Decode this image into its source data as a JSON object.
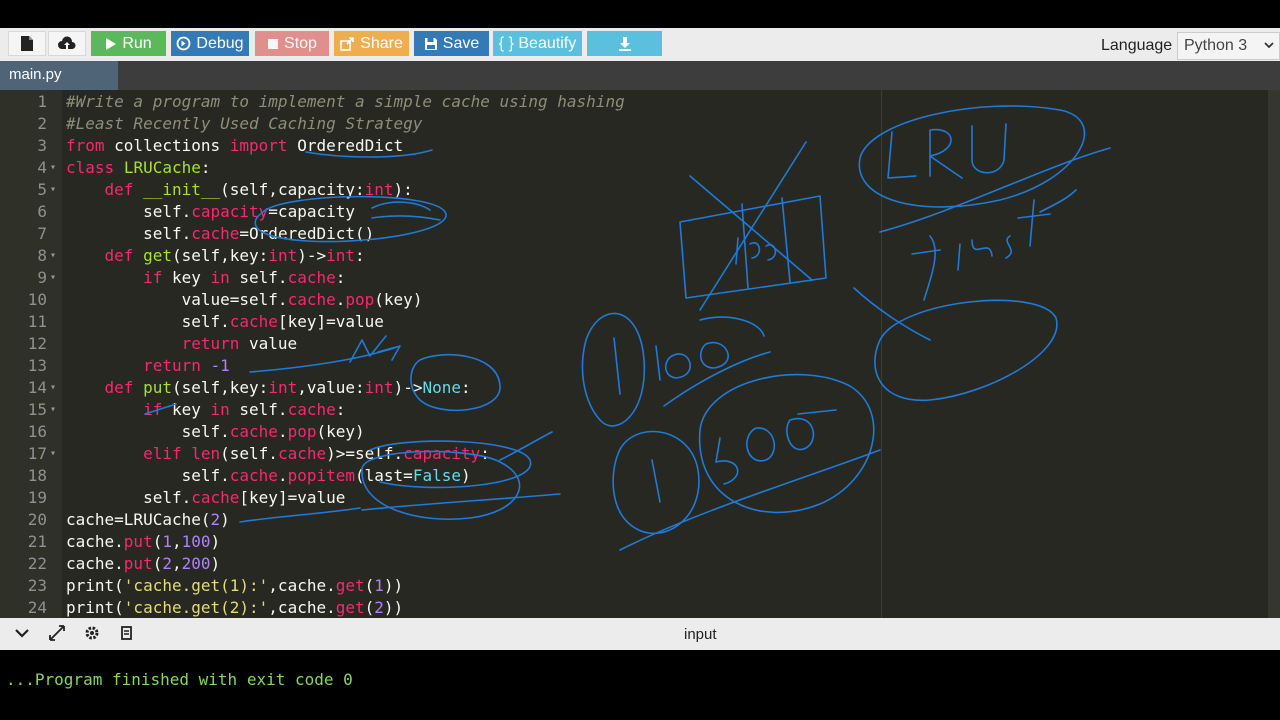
{
  "toolbar": {
    "run_label": "Run",
    "debug_label": "Debug",
    "stop_label": "Stop",
    "share_label": "Share",
    "save_label": "Save",
    "beautify_label": "{ } Beautify",
    "language_label": "Language",
    "language_value": "Python 3"
  },
  "tab": {
    "name": "main.py"
  },
  "editor": {
    "lines": [
      {
        "n": "1"
      },
      {
        "n": "2"
      },
      {
        "n": "3"
      },
      {
        "n": "4"
      },
      {
        "n": "5"
      },
      {
        "n": "6"
      },
      {
        "n": "7"
      },
      {
        "n": "8"
      },
      {
        "n": "9"
      },
      {
        "n": "10"
      },
      {
        "n": "11"
      },
      {
        "n": "12"
      },
      {
        "n": "13"
      },
      {
        "n": "14"
      },
      {
        "n": "15"
      },
      {
        "n": "16"
      },
      {
        "n": "17"
      },
      {
        "n": "18"
      },
      {
        "n": "19"
      },
      {
        "n": "20"
      },
      {
        "n": "21"
      },
      {
        "n": "22"
      },
      {
        "n": "23"
      },
      {
        "n": "24"
      }
    ],
    "code": [
      [
        [
          "c",
          "#Write a program to implement a simple cache using hashing"
        ]
      ],
      [
        [
          "c",
          "#Least Recently Used Caching Strategy"
        ]
      ],
      [
        [
          "k",
          "from"
        ],
        [
          "p",
          " collections "
        ],
        [
          "k",
          "import"
        ],
        [
          "p",
          " OrderedDict"
        ]
      ],
      [
        [
          "k",
          "class"
        ],
        [
          "p",
          " "
        ],
        [
          "f",
          "LRUCache"
        ],
        [
          "p",
          ":"
        ]
      ],
      [
        [
          "p",
          "    "
        ],
        [
          "k",
          "def"
        ],
        [
          "p",
          " "
        ],
        [
          "f",
          "__init__"
        ],
        [
          "p",
          "(self,capacity:"
        ],
        [
          "r",
          "int"
        ],
        [
          "p",
          "):"
        ]
      ],
      [
        [
          "p",
          "        self."
        ],
        [
          "r",
          "capacity"
        ],
        [
          "p",
          "=capacity"
        ]
      ],
      [
        [
          "p",
          "        self."
        ],
        [
          "r",
          "cache"
        ],
        [
          "p",
          "=OrderedDict()"
        ]
      ],
      [
        [
          "p",
          "    "
        ],
        [
          "k",
          "def"
        ],
        [
          "p",
          " "
        ],
        [
          "f",
          "get"
        ],
        [
          "p",
          "(self,key:"
        ],
        [
          "r",
          "int"
        ],
        [
          "p",
          ")->"
        ],
        [
          "r",
          "int"
        ],
        [
          "p",
          ":"
        ]
      ],
      [
        [
          "p",
          "        "
        ],
        [
          "k",
          "if"
        ],
        [
          "p",
          " key "
        ],
        [
          "k",
          "in"
        ],
        [
          "p",
          " self."
        ],
        [
          "r",
          "cache"
        ],
        [
          "p",
          ":"
        ]
      ],
      [
        [
          "p",
          "            value=self."
        ],
        [
          "r",
          "cache"
        ],
        [
          "p",
          "."
        ],
        [
          "r",
          "pop"
        ],
        [
          "p",
          "(key)"
        ]
      ],
      [
        [
          "p",
          "            self."
        ],
        [
          "r",
          "cache"
        ],
        [
          "p",
          "[key]=value"
        ]
      ],
      [
        [
          "p",
          "            "
        ],
        [
          "k",
          "return"
        ],
        [
          "p",
          " value"
        ]
      ],
      [
        [
          "p",
          "        "
        ],
        [
          "k",
          "return"
        ],
        [
          "p",
          " "
        ],
        [
          "n",
          "-1"
        ]
      ],
      [
        [
          "p",
          "    "
        ],
        [
          "k",
          "def"
        ],
        [
          "p",
          " "
        ],
        [
          "f",
          "put"
        ],
        [
          "p",
          "(self,key:"
        ],
        [
          "r",
          "int"
        ],
        [
          "p",
          ",value:"
        ],
        [
          "r",
          "int"
        ],
        [
          "p",
          ")->"
        ],
        [
          "b",
          "None"
        ],
        [
          "p",
          ":"
        ]
      ],
      [
        [
          "p",
          "        "
        ],
        [
          "k",
          "if"
        ],
        [
          "p",
          " key "
        ],
        [
          "k",
          "in"
        ],
        [
          "p",
          " self."
        ],
        [
          "r",
          "cache"
        ],
        [
          "p",
          ":"
        ]
      ],
      [
        [
          "p",
          "            self."
        ],
        [
          "r",
          "cache"
        ],
        [
          "p",
          "."
        ],
        [
          "r",
          "pop"
        ],
        [
          "p",
          "(key)"
        ]
      ],
      [
        [
          "p",
          "        "
        ],
        [
          "k",
          "elif"
        ],
        [
          "p",
          " "
        ],
        [
          "r",
          "len"
        ],
        [
          "p",
          "(self."
        ],
        [
          "r",
          "cache"
        ],
        [
          "p",
          ")>=self."
        ],
        [
          "r",
          "capacity"
        ],
        [
          "p",
          ":"
        ]
      ],
      [
        [
          "p",
          "            self."
        ],
        [
          "r",
          "cache"
        ],
        [
          "p",
          "."
        ],
        [
          "r",
          "popitem"
        ],
        [
          "p",
          "(last="
        ],
        [
          "b",
          "False"
        ],
        [
          "p",
          ")"
        ]
      ],
      [
        [
          "p",
          "        self."
        ],
        [
          "r",
          "cache"
        ],
        [
          "p",
          "[key]=value"
        ]
      ],
      [
        [
          "p",
          "cache=LRUCache("
        ],
        [
          "n",
          "2"
        ],
        [
          "p",
          ")"
        ]
      ],
      [
        [
          "p",
          "cache."
        ],
        [
          "r",
          "put"
        ],
        [
          "p",
          "("
        ],
        [
          "n",
          "1"
        ],
        [
          "p",
          ","
        ],
        [
          "n",
          "100"
        ],
        [
          "p",
          ")"
        ]
      ],
      [
        [
          "p",
          "cache."
        ],
        [
          "r",
          "put"
        ],
        [
          "p",
          "("
        ],
        [
          "n",
          "2"
        ],
        [
          "p",
          ","
        ],
        [
          "n",
          "200"
        ],
        [
          "p",
          ")"
        ]
      ],
      [
        [
          "p",
          "print("
        ],
        [
          "s",
          "'cache.get(1):'"
        ],
        [
          "p",
          ",cache."
        ],
        [
          "r",
          "get"
        ],
        [
          "p",
          "("
        ],
        [
          "n",
          "1"
        ],
        [
          "p",
          "))"
        ]
      ],
      [
        [
          "p",
          "print("
        ],
        [
          "s",
          "'cache.get(2):'"
        ],
        [
          "p",
          ",cache."
        ],
        [
          "r",
          "get"
        ],
        [
          "p",
          "("
        ],
        [
          "n",
          "2"
        ],
        [
          "p",
          "))"
        ]
      ]
    ],
    "fold_lines": [
      "4",
      "5",
      "8",
      "9",
      "14",
      "15",
      "17"
    ]
  },
  "console": {
    "input_label": "input",
    "output_text": "...Program finished with exit code 0"
  },
  "annotations": {
    "text": [
      "LRU",
      "first",
      "100",
      "1",
      "1",
      "500"
    ]
  }
}
